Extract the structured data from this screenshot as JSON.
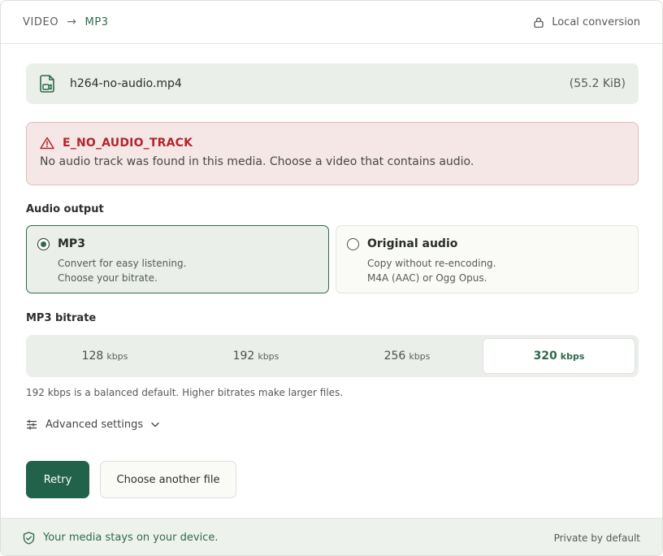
{
  "header": {
    "from": "VIDEO",
    "to": "MP3",
    "local_label": "Local conversion"
  },
  "file": {
    "name": "h264-no-audio.mp4",
    "size": "(55.2 KiB)"
  },
  "error": {
    "code": "E_NO_AUDIO_TRACK",
    "message": "No audio track was found in this media. Choose a video that contains audio."
  },
  "audio_output": {
    "label": "Audio output",
    "options": [
      {
        "title": "MP3",
        "line1": "Convert for easy listening.",
        "line2": "Choose your bitrate.",
        "selected": true
      },
      {
        "title": "Original audio",
        "line1": "Copy without re-encoding.",
        "line2": "M4A (AAC) or Ogg Opus.",
        "selected": false
      }
    ]
  },
  "bitrate": {
    "label": "MP3 bitrate",
    "unit": "kbps",
    "options": [
      "128",
      "192",
      "256",
      "320"
    ],
    "selected": "320",
    "hint": "192 kbps is a balanced default. Higher bitrates make larger files."
  },
  "advanced": {
    "label": "Advanced settings"
  },
  "actions": {
    "retry": "Retry",
    "choose": "Choose another file"
  },
  "footer": {
    "left": "Your media stays on your device.",
    "right": "Private by default"
  },
  "colors": {
    "accent": "#2f6a4c",
    "error": "#b3262a"
  }
}
